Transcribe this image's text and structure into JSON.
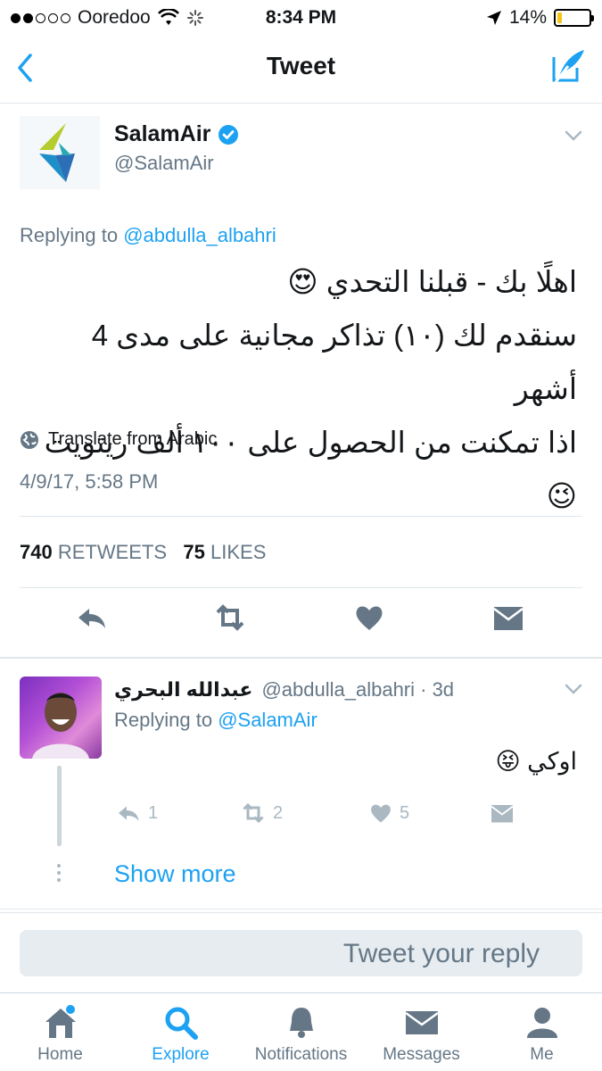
{
  "status_bar": {
    "carrier": "Ooredoo",
    "time": "8:34 PM",
    "battery": "14%",
    "battery_level": 0.14
  },
  "nav": {
    "title": "Tweet"
  },
  "tweet": {
    "display_name": "SalamAir",
    "handle": "@SalamAir",
    "replying_prefix": "Replying to ",
    "replying_to": "@abdulla_albahri",
    "text_lines": [
      "اهلًا بك - قبلنا التحدي 😍",
      "سنقدم لك (١٠) تذاكر مجانية على مدى 4 أشهر",
      "اذا تمكنت من الحصول على ١٠٠ ألف ريتويت 😉"
    ],
    "translate": "Translate from Arabic",
    "date": "4/9/17, 5:58 PM",
    "retweets_count": "740",
    "retweets_label": "RETWEETS",
    "likes_count": "75",
    "likes_label": "LIKES"
  },
  "reply": {
    "display_name": "عبدالله البحري",
    "meta": "@abdulla_albahri · 3d",
    "replying_prefix": "Replying to ",
    "replying_to": "@SalamAir",
    "text": "اوكي 😝",
    "reply_count": "1",
    "retweet_count": "2",
    "like_count": "5",
    "show_more": "Show more"
  },
  "reply_box": {
    "placeholder": "Tweet your reply"
  },
  "tab_bar": {
    "home": "Home",
    "explore": "Explore",
    "notifications": "Notifications",
    "messages": "Messages",
    "me": "Me"
  },
  "colors": {
    "accent": "#1da1f2",
    "muted": "#657786",
    "divider": "#e1e8ed"
  }
}
